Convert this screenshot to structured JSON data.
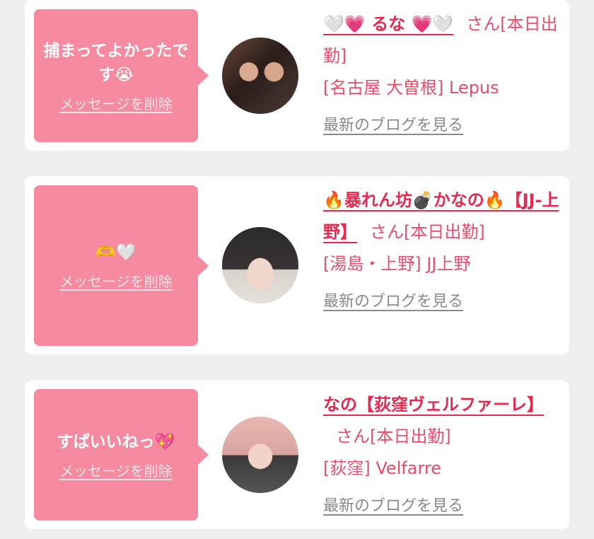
{
  "items": [
    {
      "message": "捕まってよかったです😭",
      "delete_label": "メッセージを削除",
      "name": "🤍💗 るな 💗🤍",
      "suffix": "さん[本日出勤]",
      "shop": "[名古屋 大曽根] Lepus",
      "blog_label": "最新のブログを見る"
    },
    {
      "message": "🫶🤍",
      "delete_label": "メッセージを削除",
      "name": "🔥暴れん坊💣かなの🔥【JJ-上野】",
      "suffix": "さん[本日出勤]",
      "shop": "[湯島・上野] JJ上野",
      "blog_label": "最新のブログを見る"
    },
    {
      "message": "すぱいいねっ💖",
      "delete_label": "メッセージを削除",
      "name": "なの【荻窪ヴェルファーレ】",
      "suffix": "さん[本日出勤]",
      "shop": "[荻窪] Velfarre",
      "blog_label": "最新のブログを見る"
    }
  ],
  "colors": {
    "bubble": "#f58aa0",
    "name": "#e8294f",
    "text": "#e84d6d",
    "link_gray": "#8a8a8a",
    "background": "#efefef"
  }
}
